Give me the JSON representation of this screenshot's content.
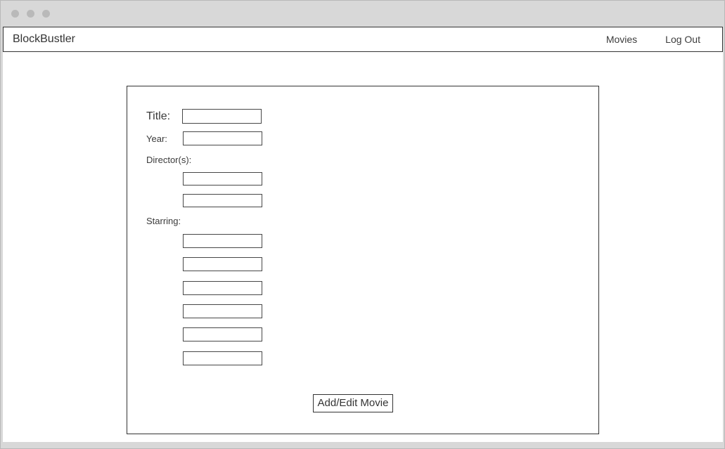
{
  "colors": {
    "chrome": "#d8d8d8",
    "chrome_border": "#b9b9b9",
    "window_dot": "#b9b9b9",
    "border_dark": "#333333",
    "text": "#333333",
    "surface": "#ffffff"
  },
  "navbar": {
    "brand": "BlockBustler",
    "links": [
      {
        "label": "Movies"
      },
      {
        "label": "Log Out"
      }
    ]
  },
  "form": {
    "title": {
      "label": "Title:",
      "value": "",
      "placeholder": ""
    },
    "year": {
      "label": "Year:",
      "value": "",
      "placeholder": ""
    },
    "directors": {
      "label": "Director(s):",
      "inputs": [
        {
          "value": "",
          "placeholder": ""
        },
        {
          "value": "",
          "placeholder": ""
        }
      ]
    },
    "starring": {
      "label": "Starring:",
      "inputs": [
        {
          "value": "",
          "placeholder": ""
        },
        {
          "value": "",
          "placeholder": ""
        },
        {
          "value": "",
          "placeholder": ""
        },
        {
          "value": "",
          "placeholder": ""
        },
        {
          "value": "",
          "placeholder": ""
        },
        {
          "value": "",
          "placeholder": ""
        }
      ]
    },
    "submit_label": "Add/Edit Movie"
  }
}
